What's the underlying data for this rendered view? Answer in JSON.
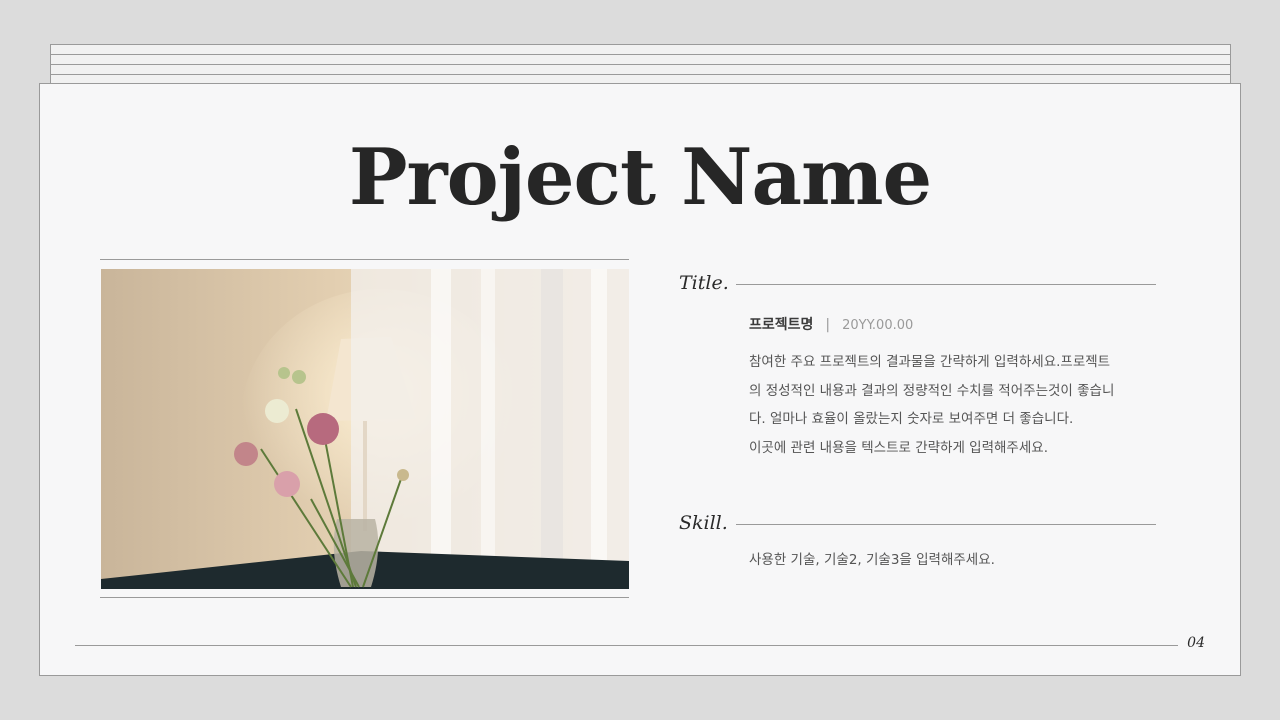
{
  "slide": {
    "title": "Project Name",
    "page_number": "04"
  },
  "title_section": {
    "label": "Title.",
    "project_name": "프로젝트명",
    "separator": "|",
    "date": "20YY.00.00",
    "description_lines": [
      "참여한 주요 프로젝트의 결과물을 간략하게 입력하세요.프로젝트",
      "의 정성적인 내용과 결과의 정량적인 수치를 적어주는것이 좋습니",
      "다. 얼마나 효율이 올랐는지 숫자로 보여주면 더 좋습니다.",
      "이곳에 관련 내용을 텍스트로 간략하게 입력해주세요."
    ]
  },
  "skill_section": {
    "label": "Skill.",
    "text": "사용한 기술, 기술2, 기술3을 입력해주세요."
  },
  "colors": {
    "background": "#dcdcdc",
    "page": "#f7f7f8",
    "rule": "#9a9a9a",
    "heading": "#262626",
    "body": "#555555"
  }
}
